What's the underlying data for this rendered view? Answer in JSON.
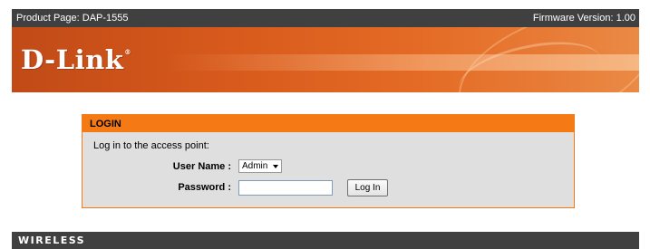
{
  "topbar": {
    "product_page": "Product Page: DAP-1555",
    "firmware_version": "Firmware Version: 1.00"
  },
  "banner": {
    "logo_text": "D-Link",
    "logo_mark": "®"
  },
  "login": {
    "title": "LOGIN",
    "description": "Log in to the access point:",
    "username_label": "User Name :",
    "username_value": "Admin",
    "password_label": "Password :",
    "password_value": "",
    "login_button": "Log In"
  },
  "footer": {
    "label": "WIRELESS"
  },
  "colors": {
    "accent_orange": "#f57a16",
    "banner_orange": "#d85a1c",
    "dark_bar": "#404040"
  }
}
